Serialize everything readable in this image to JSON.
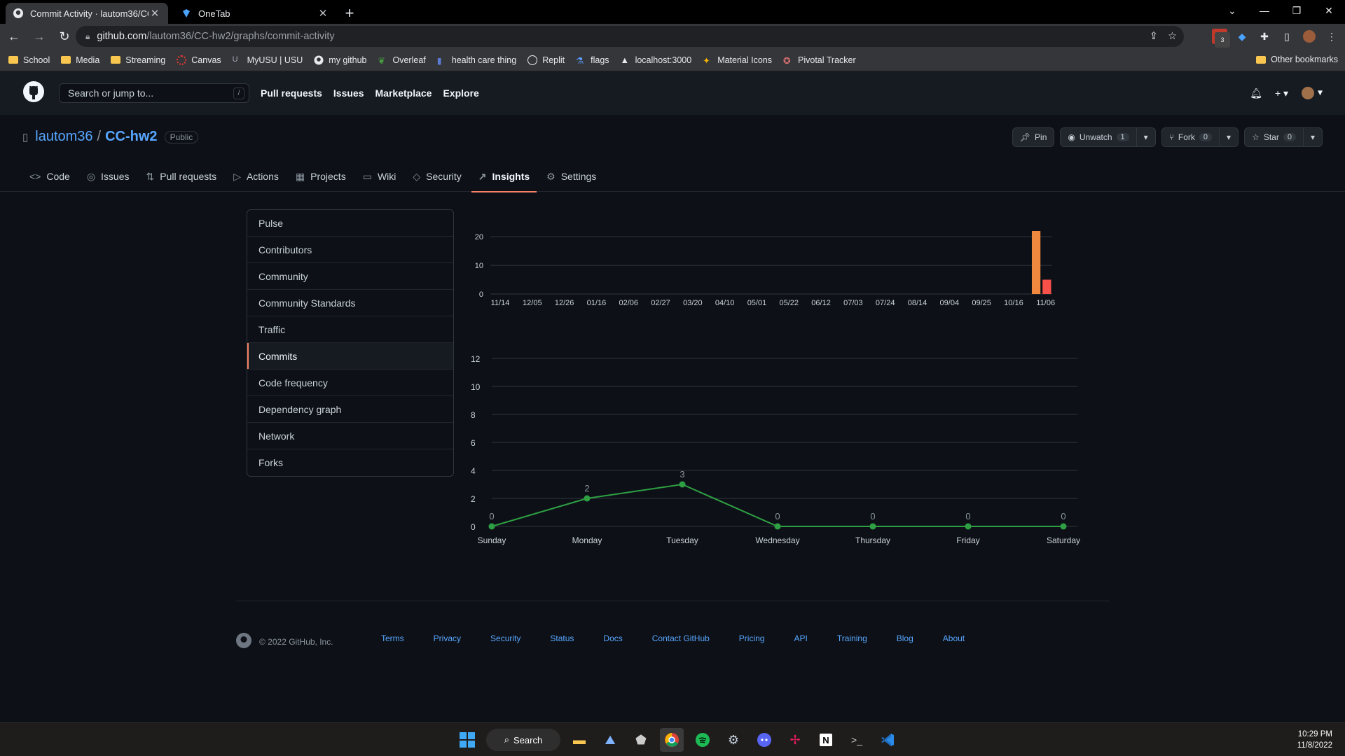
{
  "browser": {
    "tabs": [
      {
        "title": "Commit Activity · lautom36/CC-h"
      },
      {
        "title": "OneTab"
      }
    ],
    "url_host": "github.com",
    "url_path": "/lautom36/CC-hw2/graphs/commit-activity",
    "bookmarks": [
      "School",
      "Media",
      "Streaming",
      "Canvas",
      "MyUSU | USU",
      "my github",
      "Overleaf",
      "health care thing",
      "Replit",
      "flags",
      "localhost:3000",
      "Material Icons",
      "Pivotal Tracker"
    ],
    "other_bookmarks": "Other bookmarks",
    "extension_badge": "3"
  },
  "gh": {
    "search_placeholder": "Search or jump to...",
    "search_shortcut": "/",
    "nav": [
      "Pull requests",
      "Issues",
      "Marketplace",
      "Explore"
    ]
  },
  "repo": {
    "owner": "lautom36",
    "separator": "/",
    "name": "CC-hw2",
    "visibility": "Public",
    "pin_label": "Pin",
    "unwatch_label": "Unwatch",
    "watch_count": "1",
    "fork_label": "Fork",
    "fork_count": "0",
    "star_label": "Star",
    "star_count": "0",
    "tabs": [
      {
        "label": "Code",
        "icon": "<>"
      },
      {
        "label": "Issues",
        "icon": "◎"
      },
      {
        "label": "Pull requests",
        "icon": "⇅"
      },
      {
        "label": "Actions",
        "icon": "▷"
      },
      {
        "label": "Projects",
        "icon": "▦"
      },
      {
        "label": "Wiki",
        "icon": "▭"
      },
      {
        "label": "Security",
        "icon": "◇"
      },
      {
        "label": "Insights",
        "icon": "↗"
      },
      {
        "label": "Settings",
        "icon": "⚙"
      }
    ],
    "active_tab": "Insights"
  },
  "sidebar": {
    "items": [
      "Pulse",
      "Contributors",
      "Community",
      "Community Standards",
      "Traffic",
      "Commits",
      "Code frequency",
      "Dependency graph",
      "Network",
      "Forks"
    ],
    "selected": "Commits"
  },
  "chart_data": [
    {
      "type": "bar",
      "categories": [
        "11/14",
        "12/05",
        "12/26",
        "01/16",
        "02/06",
        "02/27",
        "03/20",
        "04/10",
        "05/01",
        "05/22",
        "06/12",
        "07/03",
        "07/24",
        "08/14",
        "09/04",
        "09/25",
        "10/16",
        "11/06"
      ],
      "weekly_values": [
        0,
        0,
        0,
        0,
        0,
        0,
        0,
        0,
        0,
        0,
        0,
        0,
        0,
        0,
        0,
        0,
        0,
        0,
        0,
        0,
        0,
        0,
        0,
        0,
        0,
        0,
        0,
        0,
        0,
        0,
        0,
        0,
        0,
        0,
        0,
        0,
        0,
        0,
        0,
        0,
        0,
        0,
        0,
        0,
        0,
        0,
        0,
        0,
        0,
        0,
        22,
        5
      ],
      "yticks": [
        0,
        10,
        20
      ],
      "ylim": [
        0,
        22
      ],
      "colors": {
        "bar": "#f0883e",
        "selected": "#f85149"
      },
      "selected_week": "11/06"
    },
    {
      "type": "line",
      "categories": [
        "Sunday",
        "Monday",
        "Tuesday",
        "Wednesday",
        "Thursday",
        "Friday",
        "Saturday"
      ],
      "values": [
        0,
        2,
        3,
        0,
        0,
        0,
        0
      ],
      "yticks": [
        0,
        2,
        4,
        6,
        8,
        10,
        12
      ],
      "ylim": [
        0,
        12
      ],
      "colors": {
        "line": "#2ea043"
      }
    }
  ],
  "footer": {
    "copyright": "© 2022 GitHub, Inc.",
    "links": [
      "Terms",
      "Privacy",
      "Security",
      "Status",
      "Docs",
      "Contact GitHub",
      "Pricing",
      "API",
      "Training",
      "Blog",
      "About"
    ]
  },
  "taskbar": {
    "search_label": "Search",
    "time": "10:29 PM",
    "date": "11/8/2022"
  }
}
